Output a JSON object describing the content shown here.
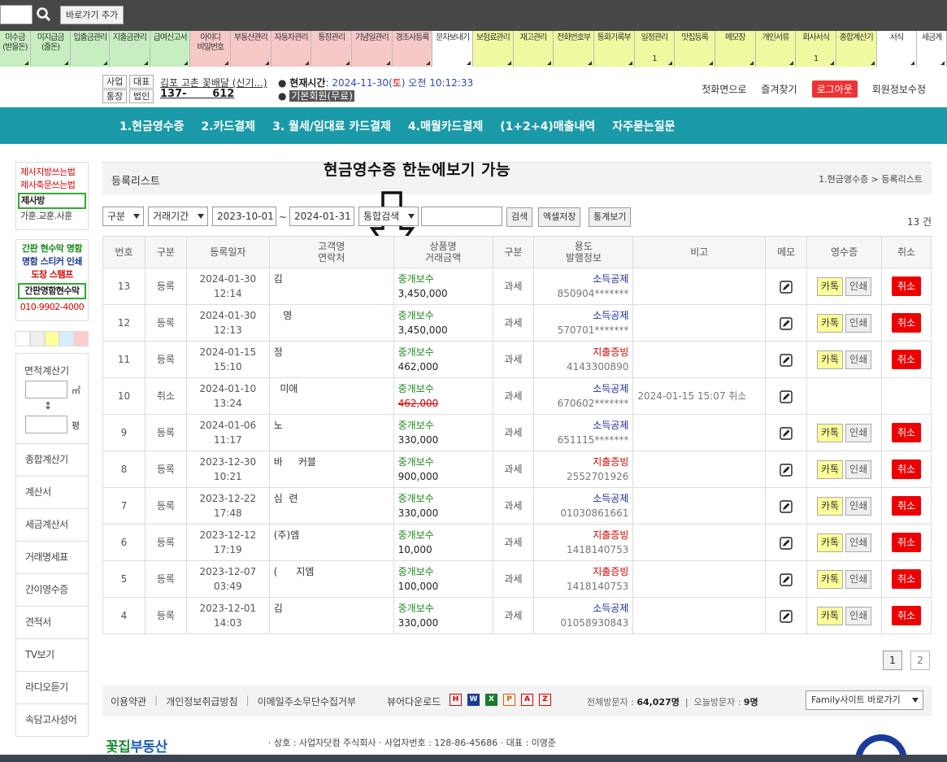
{
  "topbar": {
    "add_shortcut": "바로가기 추가"
  },
  "menu": [
    {
      "label": "미수금",
      "sub": "(받을돈)",
      "bg": "#c6eec0",
      "w": 38
    },
    {
      "label": "미지급금",
      "sub": "(줄돈)",
      "bg": "#c6eec0",
      "w": 50
    },
    {
      "label": "입출금관리",
      "sub": "",
      "bg": "#c6eec0",
      "w": 48
    },
    {
      "label": "지출금관리",
      "sub": "",
      "bg": "#c6eec0",
      "w": 50
    },
    {
      "label": "급여신고서",
      "sub": "",
      "bg": "#c6eec0",
      "w": 50
    },
    {
      "label": "아이디",
      "sub": "비밀번호",
      "bg": "#f6c8c8",
      "w": 50
    },
    {
      "label": "부동산관리",
      "sub": "",
      "bg": "#f6c8c8",
      "w": 50
    },
    {
      "label": "자동차관리",
      "sub": "",
      "bg": "#f6c8c8",
      "w": 50
    },
    {
      "label": "통장관리",
      "sub": "",
      "bg": "#f6c8c8",
      "w": 50
    },
    {
      "label": "기념일관리",
      "sub": "",
      "bg": "#f6c8c8",
      "w": 50
    },
    {
      "label": "경조사등록",
      "sub": "",
      "bg": "#f6c8c8",
      "w": 50
    },
    {
      "label": "문자보내기",
      "sub": "",
      "bg": "#ffffff",
      "w": 50
    },
    {
      "label": "보험료관리",
      "sub": "",
      "bg": "#f0f8a0",
      "w": 50
    },
    {
      "label": "재고관리",
      "sub": "",
      "bg": "#f0f8a0",
      "w": 50
    },
    {
      "label": "전화번호부",
      "sub": "",
      "bg": "#f0f8a0",
      "w": 50
    },
    {
      "label": "통화기록부",
      "sub": "",
      "bg": "#f0f8a0",
      "w": 50
    },
    {
      "label": "일정관리",
      "sub": "",
      "count": "1",
      "bg": "#f0f8a0",
      "w": 50
    },
    {
      "label": "맛집등록",
      "sub": "",
      "bg": "#f0f8a0",
      "w": 50
    },
    {
      "label": "메모장",
      "sub": "",
      "bg": "#f0f8a0",
      "w": 50
    },
    {
      "label": "개인서류",
      "sub": "",
      "bg": "#f0f8a0",
      "w": 50
    },
    {
      "label": "회사서식",
      "sub": "",
      "count": "1",
      "bg": "#f0f8a0",
      "w": 50
    },
    {
      "label": "종합계산기",
      "sub": "",
      "bg": "#f0f8a0",
      "w": 50
    },
    {
      "label": "서식",
      "sub": "",
      "bg": "#ffffff",
      "w": 50
    },
    {
      "label": "세금계",
      "sub": "",
      "bg": "#ffffff",
      "w": 37
    }
  ],
  "header": {
    "tags": [
      "사업",
      "대표",
      "통장",
      "법인"
    ],
    "bizname": "김포 고촌 꽃배달 (신기...)",
    "biznum": "137-       612",
    "clock_label": "현재시간",
    "clock_date": ": 2024-11-30(",
    "clock_day": "토",
    "clock_time": ") 오전 10:12:33",
    "member": "기본회원(무료)",
    "links": [
      "첫화면으로",
      "즐겨찾기",
      "로그아웃",
      "회원정보수정"
    ]
  },
  "nav": [
    "1.현금영수증",
    "2.카드결제",
    "3. 월세/임대료 카드결제",
    "4.매월카드결제",
    "(1+2+4)매출내역",
    "자주묻는질문"
  ],
  "sidebar": {
    "box1": [
      "제사지방쓰는법",
      "제사축문쓰는법",
      "제사방",
      "가훈.교훈.사훈"
    ],
    "box2": [
      "간판 현수막 명함",
      "명함 스티커 인쇄",
      "도장 스탬프",
      "간판명함현수막",
      "010-9902-4000"
    ],
    "swatch_colors": [
      "#ffffff",
      "#eeeeee",
      "#ffff99",
      "#d8ecff",
      "#ffcccc"
    ],
    "calc_label": "면적계산기",
    "unit1": "㎡",
    "arrow": "↕",
    "unit2": "평",
    "links": [
      "종합계산기",
      "계산서",
      "세금계산서",
      "거래명세표",
      "간이영수증",
      "견적서",
      "TV보기",
      "라디오듣기",
      "속담고사성어"
    ]
  },
  "page": {
    "title": "등록리스트",
    "breadcrumb": "1.현금영수증 > 등록리스트",
    "overlay": "현금영수증 한눈에보기 가능"
  },
  "filters": {
    "type": "구분",
    "period": "거래기간",
    "date_from": "2023-10-01",
    "tilde": "~",
    "date_to": "2024-01-31",
    "search_field": "통합검색",
    "search_btn": "검색",
    "excel_btn": "엑셀저장",
    "stats_btn": "통계보기",
    "count": "13 건"
  },
  "table": {
    "headers": {
      "no": "번호",
      "type": "구분",
      "date": "등록일자",
      "customer": "고객명",
      "contact": "연락처",
      "product": "상품명",
      "amount": "거래금액",
      "tax": "구분",
      "use": "용도",
      "issue": "발행정보",
      "note": "비고",
      "memo": "메모",
      "receipt": "영수증",
      "cancel": "취소"
    },
    "kakao": "카톡",
    "print": "인쇄",
    "cancel_btn": "취소",
    "rows": [
      {
        "no": "13",
        "type": "등록",
        "date": "2024-01-30",
        "time": "12:14",
        "name": "김     ",
        "item": "중개보수",
        "amount": "3,450,000",
        "tax": "과세",
        "use": "소득공제",
        "issue": "850904*******",
        "note": "",
        "cancelled": false
      },
      {
        "no": "12",
        "type": "등록",
        "date": "2024-01-30",
        "time": "12:13",
        "name": "   영",
        "item": "중개보수",
        "amount": "3,450,000",
        "tax": "과세",
        "use": "소득공제",
        "issue": "570701*******",
        "note": "",
        "cancelled": false
      },
      {
        "no": "11",
        "type": "등록",
        "date": "2024-01-15",
        "time": "15:10",
        "name": "정   ",
        "item": "중개보수",
        "amount": "462,000",
        "tax": "과세",
        "use": "지출증빙",
        "issue": "4143300890",
        "note": "",
        "cancelled": false
      },
      {
        "no": "10",
        "type": "취소",
        "date": "2024-01-10",
        "time": "13:24",
        "name": "  미애",
        "item": "중개보수",
        "amount": "462,000",
        "tax": "과세",
        "use": "소득공제",
        "issue": "670602*******",
        "note": "2024-01-15 15:07 취소",
        "cancelled": true
      },
      {
        "no": "9",
        "type": "등록",
        "date": "2024-01-06",
        "time": "11:17",
        "name": "노   ",
        "item": "중개보수",
        "amount": "330,000",
        "tax": "과세",
        "use": "소득공제",
        "issue": "651115*******",
        "note": "",
        "cancelled": false
      },
      {
        "no": "8",
        "type": "등록",
        "date": "2023-12-30",
        "time": "10:21",
        "name": "바     커블",
        "item": "중개보수",
        "amount": "900,000",
        "tax": "과세",
        "use": "지출증빙",
        "issue": "2552701926",
        "note": "",
        "cancelled": false
      },
      {
        "no": "7",
        "type": "등록",
        "date": "2023-12-22",
        "time": "17:48",
        "name": "심  련",
        "item": "중개보수",
        "amount": "330,000",
        "tax": "과세",
        "use": "소득공제",
        "issue": "01030861661",
        "note": "",
        "cancelled": false
      },
      {
        "no": "6",
        "type": "등록",
        "date": "2023-12-12",
        "time": "17:19",
        "name": "(주)엠   ",
        "item": "중개보수",
        "amount": "10,000",
        "tax": "과세",
        "use": "지출증빙",
        "issue": "1418140753",
        "note": "",
        "cancelled": false
      },
      {
        "no": "5",
        "type": "등록",
        "date": "2023-12-07",
        "time": "03:49",
        "name": "(      지엠",
        "item": "중개보수",
        "amount": "100,000",
        "tax": "과세",
        "use": "지출증빙",
        "issue": "1418140753",
        "note": "",
        "cancelled": false
      },
      {
        "no": "4",
        "type": "등록",
        "date": "2023-12-01",
        "time": "14:03",
        "name": "김    ",
        "item": "중개보수",
        "amount": "330,000",
        "tax": "과세",
        "use": "소득공제",
        "issue": "01058930843",
        "note": "",
        "cancelled": false
      }
    ]
  },
  "pager": [
    "1",
    "2"
  ],
  "footer": {
    "links": [
      "이용약관",
      "개인정보취급방침",
      "이메일주소무단수집거부"
    ],
    "viewer": "뷰어다운로드",
    "viewer_icons": [
      "H",
      "W",
      "X",
      "P",
      "A",
      "Z"
    ],
    "visits_total_label": "전체방문자 :",
    "visits_total": "64,027명",
    "visits_today_label": "오늘방문자 :",
    "visits_today": "9명",
    "family": "Family사이트 바로가기",
    "company": "· 상호 : 사업자닷컴 주식회사   · 사업자번호 : 128-86-45686   · 대표 : 이영준",
    "logo_a": "꽃집",
    "logo_b": "부동산"
  }
}
